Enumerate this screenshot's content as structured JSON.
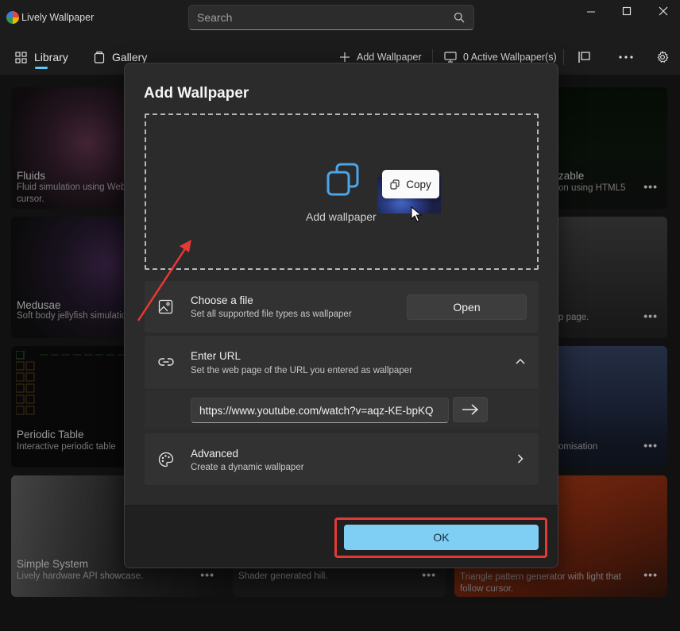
{
  "app": {
    "title": "Lively Wallpaper"
  },
  "search": {
    "placeholder": "Search"
  },
  "nav": {
    "library": "Library",
    "gallery": "Gallery",
    "add_wallpaper": "Add Wallpaper",
    "active_wallpapers": "0 Active Wallpaper(s)"
  },
  "cards": [
    {
      "title": "Fluids",
      "desc": "Fluid simulation using WebGL, system audio & cursor."
    },
    {
      "title": "Medusae",
      "desc": "Soft body jellyfish simulation."
    },
    {
      "title": "Periodic Table",
      "desc": "Interactive periodic table"
    },
    {
      "title": "Simple System",
      "desc": "Lively hardware API showcase."
    },
    {
      "title": "",
      "desc": "Shader generated hill."
    },
    {
      "title": "zable",
      "desc": "on using HTML5"
    },
    {
      "title": "",
      "desc": "p page."
    },
    {
      "title": "",
      "desc": "omisation"
    },
    {
      "title": "",
      "desc": "Triangle pattern generator with light that follow cursor."
    }
  ],
  "dialog": {
    "title": "Add Wallpaper",
    "drop_label": "Add wallpaper",
    "copy_tooltip": "Copy",
    "choose_file": {
      "title": "Choose a file",
      "subtitle": "Set all supported file types as wallpaper",
      "button": "Open"
    },
    "enter_url": {
      "title": "Enter URL",
      "subtitle": "Set the web page of the URL you entered as wallpaper",
      "value": "https://www.youtube.com/watch?v=aqz-KE-bpKQ"
    },
    "advanced": {
      "title": "Advanced",
      "subtitle": "Create a dynamic wallpaper"
    },
    "ok": "OK"
  },
  "colors": {
    "accent": "#7fcff5",
    "highlight": "#e53935",
    "indicator": "#5ac8fa"
  }
}
